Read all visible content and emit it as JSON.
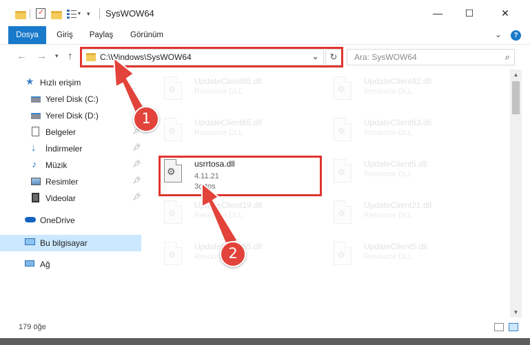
{
  "window": {
    "title": "SysWOW64",
    "controls": {
      "minimize": "—",
      "maximize": "☐",
      "close": "✕"
    }
  },
  "ribbon": {
    "tabs": [
      {
        "label": "Dosya",
        "active": true
      },
      {
        "label": "Giriş"
      },
      {
        "label": "Paylaş"
      },
      {
        "label": "Görünüm"
      }
    ],
    "expand_glyph": "⌄",
    "help_glyph": "?"
  },
  "address_bar": {
    "path": "C:\\Windows\\SysWOW64",
    "dropdown_glyph": "⌄",
    "refresh_glyph": "↻"
  },
  "search": {
    "placeholder": "Ara: SysWOW64"
  },
  "nav_pane": {
    "quick_access": "Hızlı erişim",
    "items": [
      {
        "label": "Yerel Disk (C:)",
        "icon": "drive-icon"
      },
      {
        "label": "Yerel Disk (D:)",
        "icon": "drive-icon"
      },
      {
        "label": "Belgeler",
        "icon": "documents-icon",
        "pinned": true
      },
      {
        "label": "İndirmeler",
        "icon": "download-icon",
        "pinned": true
      },
      {
        "label": "Müzik",
        "icon": "music-icon",
        "pinned": true
      },
      {
        "label": "Resimler",
        "icon": "pictures-icon",
        "pinned": true
      },
      {
        "label": "Videolar",
        "icon": "video-icon",
        "pinned": true
      }
    ],
    "onedrive": "OneDrive",
    "this_pc": "Bu bilgisayar",
    "network": "Ağ"
  },
  "files": {
    "left_column": [
      {
        "name": "UpdateClient65.dll",
        "type": "Resource DLL"
      },
      {
        "name": "UpdateClient65.dll",
        "type": "Resource DLL"
      },
      {
        "name": "usrrtosa.dll",
        "version": "4.11.21",
        "company": "3ortos",
        "highlighted": true
      },
      {
        "name": "UpdateClient19.dll",
        "type": "Resource DLL"
      },
      {
        "name": "UpdateClient65.dll",
        "type": "Resource DLL"
      }
    ],
    "right_column": [
      {
        "name": "UpdateClient42.dll",
        "type": "Resource DLL"
      },
      {
        "name": "UpdateClient63.dll",
        "type": "Resource DLL"
      },
      {
        "name": "UpdateClient5.dll",
        "type": "Resource DLL"
      },
      {
        "name": "UpdateClient21.dll",
        "type": "Resource DLL"
      },
      {
        "name": "UpdateClient5.dll",
        "type": "Resource DLL"
      }
    ]
  },
  "status_bar": {
    "item_count": "179 öğe"
  },
  "callouts": {
    "one": "1",
    "two": "2"
  },
  "colors": {
    "accent": "#1979ca",
    "highlight_red": "#e0352f",
    "selection": "#cce8ff"
  }
}
